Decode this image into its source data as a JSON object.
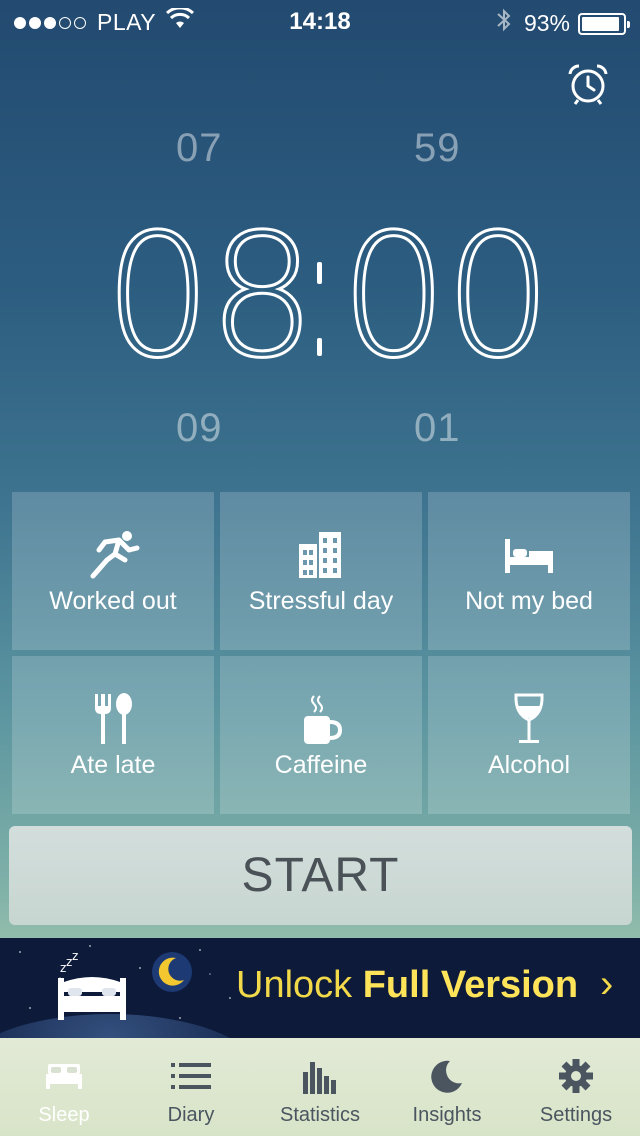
{
  "status_bar": {
    "signal_dots_filled": 3,
    "signal_dots_total": 5,
    "carrier": "PLAY",
    "time": "14:18",
    "battery_percent": "93%",
    "battery_level": 0.93
  },
  "alarm_icon": "alarm-clock-icon",
  "time_picker": {
    "hour_prev": "07",
    "minute_prev": "59",
    "hour": "08",
    "minute": "00",
    "hour_next": "09",
    "minute_next": "01"
  },
  "factors": [
    {
      "label": "Worked out",
      "icon": "running-icon"
    },
    {
      "label": "Stressful day",
      "icon": "buildings-icon"
    },
    {
      "label": "Not my bed",
      "icon": "bed-icon"
    },
    {
      "label": "Ate late",
      "icon": "fork-spoon-icon"
    },
    {
      "label": "Caffeine",
      "icon": "coffee-cup-icon"
    },
    {
      "label": "Alcohol",
      "icon": "wine-glass-icon"
    }
  ],
  "start_label": "START",
  "banner": {
    "text_plain": "Unlock ",
    "text_bold": "Full Version",
    "arrow": "›"
  },
  "tabs": [
    {
      "label": "Sleep",
      "icon": "bed-icon",
      "active": true
    },
    {
      "label": "Diary",
      "icon": "list-icon",
      "active": false
    },
    {
      "label": "Statistics",
      "icon": "bar-chart-icon",
      "active": false
    },
    {
      "label": "Insights",
      "icon": "moon-icon",
      "active": false
    },
    {
      "label": "Settings",
      "icon": "gear-icon",
      "active": false
    }
  ],
  "colors": {
    "banner_text": "#f2d94a",
    "tab_label": "#4a5560",
    "start_text": "#4a5258"
  }
}
